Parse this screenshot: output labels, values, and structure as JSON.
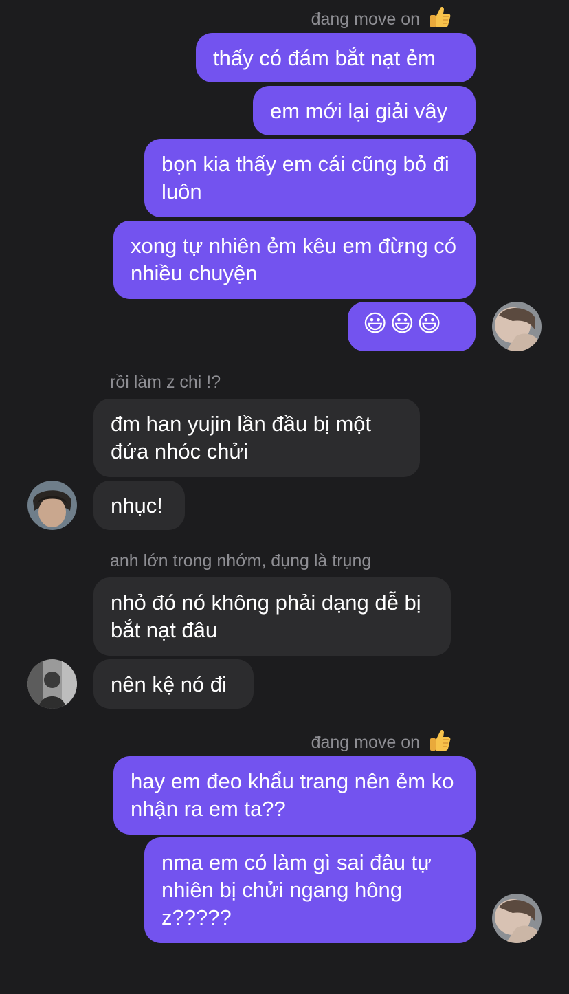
{
  "groups": [
    {
      "sender": "đang move on",
      "sender_emoji": "thumbs-up",
      "direction": "outgoing",
      "messages": [
        "thấy có đám bắt nạt ẻm",
        "em mới lại giải vây",
        "bọn kia thấy em cái cũng bỏ đi luôn",
        "xong tự nhiên ẻm kêu em đừng có nhiều chuyện",
        "😃😃😃"
      ]
    },
    {
      "sender": "rồi làm z chi !?",
      "direction": "incoming",
      "messages": [
        "đm han yujin lần đầu bị một đứa nhóc chửi",
        "nhục!"
      ]
    },
    {
      "sender": "anh lớn trong nhớm, đụng là trụng",
      "direction": "incoming",
      "messages": [
        "nhỏ đó nó không phải dạng dễ bị bắt nạt đâu",
        "nên kệ nó đi"
      ]
    },
    {
      "sender": "đang move on",
      "sender_emoji": "thumbs-up",
      "direction": "outgoing",
      "messages": [
        "hay em đeo khẩu trang nên ẻm ko nhận ra em ta??",
        "nma em có làm gì sai đâu tự nhiên bị chửi ngang hông z?????"
      ]
    }
  ],
  "colors": {
    "background": "#1c1c1e",
    "outgoing_bubble": "#7353ef",
    "incoming_bubble": "#2c2c2e",
    "sender_name": "#8e8e93"
  }
}
